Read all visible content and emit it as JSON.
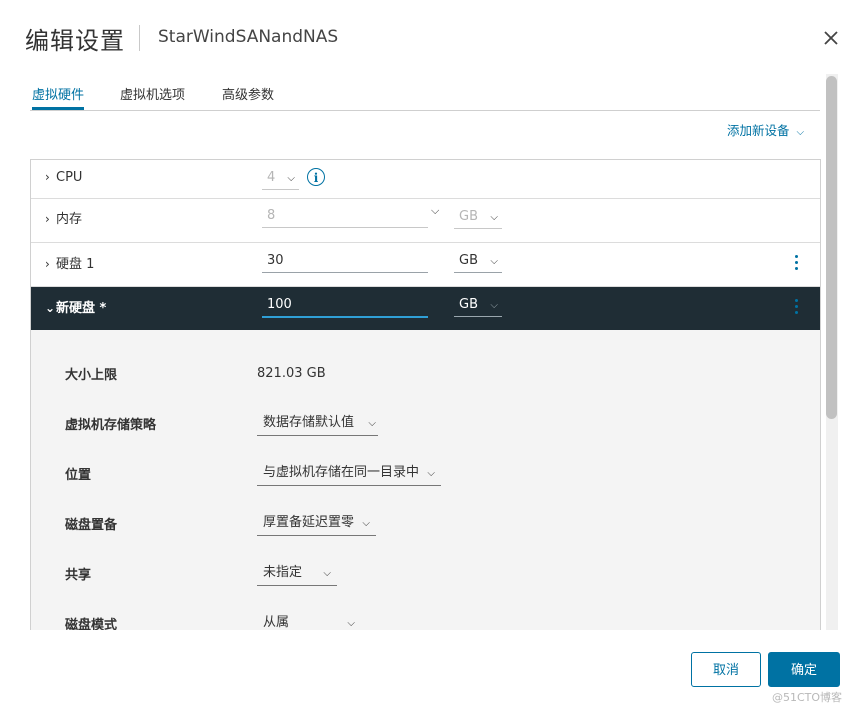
{
  "dialog": {
    "title": "编辑设置",
    "subtitle": "StarWindSANandNAS",
    "close_icon": "close-icon"
  },
  "tabs": [
    {
      "label": "虚拟硬件",
      "active": true
    },
    {
      "label": "虚拟机选项",
      "active": false
    },
    {
      "label": "高级参数",
      "active": false
    }
  ],
  "add_device": {
    "label": "添加新设备",
    "icon": "chevron-down-icon"
  },
  "hardware": {
    "cpu": {
      "label": "CPU",
      "value": "4"
    },
    "memory": {
      "label": "内存",
      "value": "8",
      "unit": "GB"
    },
    "disk1": {
      "label": "硬盘 1",
      "value": "30",
      "unit": "GB"
    },
    "new_disk": {
      "label": "新硬盘 *",
      "value": "100",
      "unit": "GB",
      "details": {
        "max_size": {
          "label": "大小上限",
          "value": "821.03 GB"
        },
        "storage_policy": {
          "label": "虚拟机存储策略",
          "value": "数据存储默认值"
        },
        "location": {
          "label": "位置",
          "value": "与虚拟机存储在同一目录中"
        },
        "provisioning": {
          "label": "磁盘置备",
          "value": "厚置备延迟置零"
        },
        "sharing": {
          "label": "共享",
          "value": "未指定"
        },
        "disk_mode": {
          "label": "磁盘模式",
          "value": "从属"
        }
      }
    }
  },
  "footer": {
    "cancel_label": "取消",
    "ok_label": "确定"
  },
  "watermark": "@51CTO博客",
  "colors": {
    "accent": "#0072a3",
    "selected_row": "#1f2d35",
    "details_bg": "#f4f4f4"
  }
}
